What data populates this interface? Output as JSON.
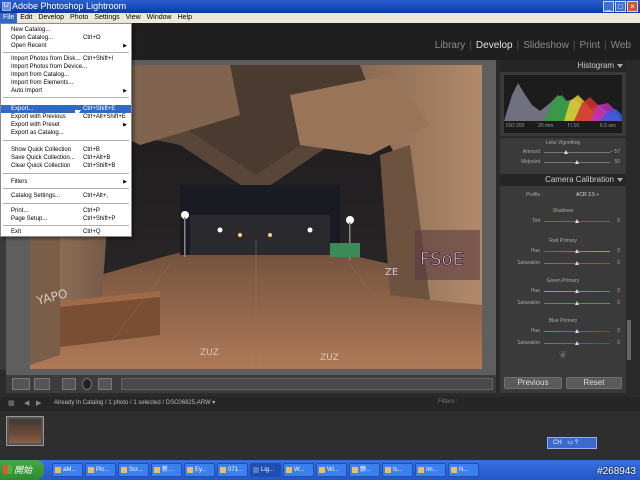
{
  "window": {
    "title": "Adobe Photoshop Lightroom",
    "icon_text": "Lr"
  },
  "menubar": [
    "File",
    "Edit",
    "Develop",
    "Photo",
    "Settings",
    "View",
    "Window",
    "Help"
  ],
  "modules": {
    "library": "Library",
    "develop": "Develop",
    "slideshow": "Slideshow",
    "print": "Print",
    "web": "Web",
    "sep": "|"
  },
  "file_menu": [
    {
      "label": "New Catalog...",
      "shortcut": ""
    },
    {
      "label": "Open Catalog...",
      "shortcut": "Ctrl+O"
    },
    {
      "label": "Open Recent",
      "shortcut": ""
    },
    {
      "label": "Import Photos from Disk...",
      "shortcut": "Ctrl+Shift+I"
    },
    {
      "label": "Import Photos from Device...",
      "shortcut": ""
    },
    {
      "label": "Import from Catalog...",
      "shortcut": ""
    },
    {
      "label": "Import from Elements...",
      "shortcut": ""
    },
    {
      "label": "Auto Import",
      "shortcut": ""
    },
    {
      "label": "Export...",
      "shortcut": "Ctrl+Shift+E"
    },
    {
      "label": "Export with Previous",
      "shortcut": "Ctrl+Alt+Shift+E"
    },
    {
      "label": "Export with Preset",
      "shortcut": ""
    },
    {
      "label": "Export as Catalog...",
      "shortcut": ""
    },
    {
      "label": "Show Quick Collection",
      "shortcut": "Ctrl+B"
    },
    {
      "label": "Save Quick Collection...",
      "shortcut": "Ctrl+Alt+B"
    },
    {
      "label": "Clear Quick Collection",
      "shortcut": "Ctrl+Shift+B"
    },
    {
      "label": "Filters",
      "shortcut": ""
    },
    {
      "label": "Catalog Settings...",
      "shortcut": "Ctrl+Alt+,"
    },
    {
      "label": "Print...",
      "shortcut": "Ctrl+P"
    },
    {
      "label": "Page Setup...",
      "shortcut": "Ctrl+Shift+P"
    },
    {
      "label": "Exit",
      "shortcut": "Ctrl+Q"
    }
  ],
  "submenu_arrow": "▶",
  "histogram": {
    "title": "Histogram",
    "iso": "ISO 200",
    "focal": "20 mm",
    "aperture": "f / 10",
    "shutter": "6.0 sec"
  },
  "lens_vignetting": {
    "title": "Lens Vignetting",
    "amount": {
      "label": "Amount",
      "value": "− 57",
      "fraction": 0.3
    },
    "midpoint": {
      "label": "Midpoint",
      "value": "50",
      "fraction": 0.5
    }
  },
  "camera_calibration": {
    "title": "Camera Calibration",
    "profile_label": "Profile :",
    "profile_value": "ACR 3.5 ÷",
    "shadows": {
      "title": "Shadows",
      "tint": {
        "label": "Tint",
        "value": "0"
      }
    },
    "red": {
      "title": "Red Primary",
      "hue": {
        "label": "Hue",
        "value": "0"
      },
      "saturation": {
        "label": "Saturation",
        "value": "0"
      }
    },
    "green": {
      "title": "Green Primary",
      "hue": {
        "label": "Hue",
        "value": "0"
      },
      "saturation": {
        "label": "Saturation",
        "value": "0"
      }
    },
    "blue": {
      "title": "Blue Primary",
      "hue": {
        "label": "Hue",
        "value": "0"
      },
      "saturation": {
        "label": "Saturation",
        "value": "0"
      }
    }
  },
  "buttons": {
    "previous": "Previous",
    "reset": "Reset"
  },
  "filmstrip": {
    "info": "Already In Catalog / 1 photo / 1 selected / DSC06825.ARW ▾",
    "filters_label": "Filters :"
  },
  "ime": {
    "label": "CH"
  },
  "taskbar": {
    "start": "開始",
    "tasks": [
      "aM...",
      "Pic...",
      "Scr...",
      "新...",
      "Ey...",
      "071...",
      "Lig...",
      "W...",
      "Wi...",
      "靜...",
      "Ic...",
      "Im...",
      "N..."
    ]
  },
  "watermark": "#268943"
}
